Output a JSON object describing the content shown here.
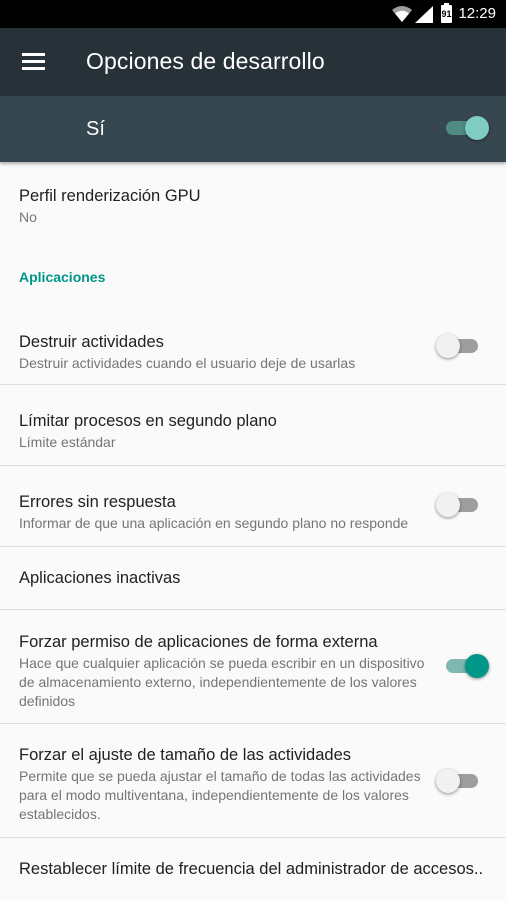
{
  "status_bar": {
    "time": "12:29",
    "battery_level": "91",
    "icons": [
      "wifi-icon",
      "signal-icon",
      "battery-icon"
    ]
  },
  "app_bar": {
    "title": "Opciones de desarrollo",
    "menu_icon": "hamburger-menu-icon"
  },
  "master_switch": {
    "label": "Sí",
    "checked": true
  },
  "items": [
    {
      "title": "Perfil renderización GPU",
      "summary": "No"
    },
    {
      "category": "Aplicaciones"
    },
    {
      "title": "Destruir actividades",
      "summary": "Destruir actividades cuando el usuario deje de usarlas",
      "toggle": false
    },
    {
      "title": "Límitar procesos en segundo plano",
      "summary": "Límite estándar"
    },
    {
      "title": "Errores sin respuesta",
      "summary": "Informar de que una aplicación en segundo plano no responde",
      "toggle": false
    },
    {
      "title": "Aplicaciones inactivas"
    },
    {
      "title": "Forzar permiso de aplicaciones de forma externa",
      "summary": "Hace que cualquier aplicación se pueda escribir en un dispositivo de almacenamiento externo, independientemente de los valores definidos",
      "toggle": true
    },
    {
      "title": "Forzar el ajuste de tamaño de las actividades",
      "summary": "Permite que se pueda ajustar el tamaño de todas las actividades para el modo multiventana, independientemente de los valores establecidos.",
      "toggle": false
    },
    {
      "title": "Restablecer límite de frecuencia del administrador de accesos.."
    }
  ],
  "colors": {
    "status_bar": "#000000",
    "app_bar": "#263238",
    "master_bar": "#37474f",
    "accent": "#009688",
    "background": "#fafafa"
  }
}
